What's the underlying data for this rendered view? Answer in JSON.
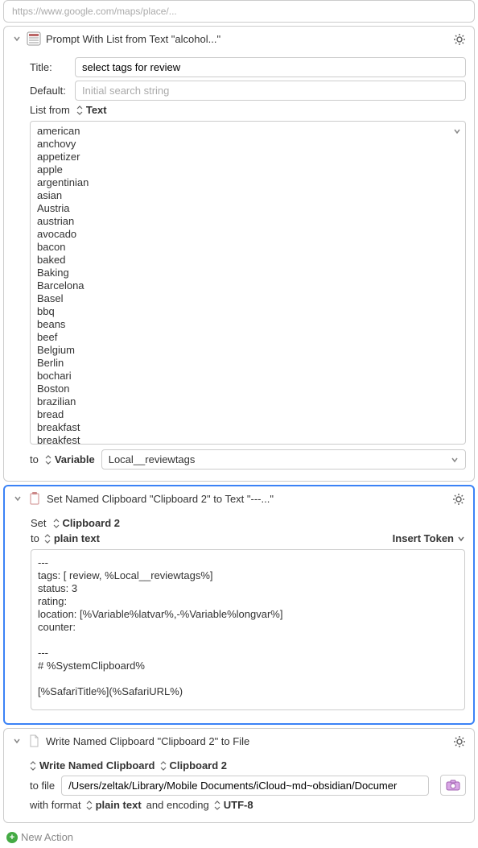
{
  "truncated_top": "https://www.google.com/maps/place/...",
  "action1": {
    "title": "Prompt With List from Text \"alcohol...\"",
    "title_label": "Title:",
    "title_value": "select tags for review",
    "default_label": "Default:",
    "default_placeholder": "Initial search string",
    "list_from_label": "List from",
    "list_from_sel": "Text",
    "list_items": [
      "american",
      "anchovy",
      "appetizer",
      "apple",
      "argentinian",
      "asian",
      "Austria",
      "austrian",
      "avocado",
      "bacon",
      "baked",
      "Baking",
      "Barcelona",
      "Basel",
      "bbq",
      "beans",
      "beef",
      "Belgium",
      "Berlin",
      "bochari",
      "Boston",
      "brazilian",
      "bread",
      "breakfast",
      "breakfest"
    ],
    "to_label": "to",
    "to_sel": "Variable",
    "var_value": "Local__reviewtags"
  },
  "action2": {
    "title": "Set Named Clipboard \"Clipboard 2\" to Text \"---...\"",
    "set_label": "Set",
    "set_sel": "Clipboard 2",
    "to_label": "to",
    "to_sel": "plain text",
    "insert_token": "Insert Token",
    "body": "---\ntags: [ review, %Local__reviewtags%]\nstatus: 3\nrating:\nlocation: [%Variable%latvar%,-%Variable%longvar%]\ncounter:\n\n---\n# %SystemClipboard%\n\n[%SafariTitle%](%SafariURL%)"
  },
  "action3": {
    "title": "Write Named Clipboard \"Clipboard 2\" to File",
    "write_sel_label": "Write Named Clipboard",
    "write_sel": "Clipboard 2",
    "tofile_label": "to file",
    "file_value": "/Users/zeltak/Library/Mobile Documents/iCloud~md~obsidian/Documer",
    "format_label": "with format",
    "format_sel": "plain text",
    "encoding_label": "and encoding",
    "encoding_sel": "UTF-8"
  },
  "new_action_label": "New Action"
}
